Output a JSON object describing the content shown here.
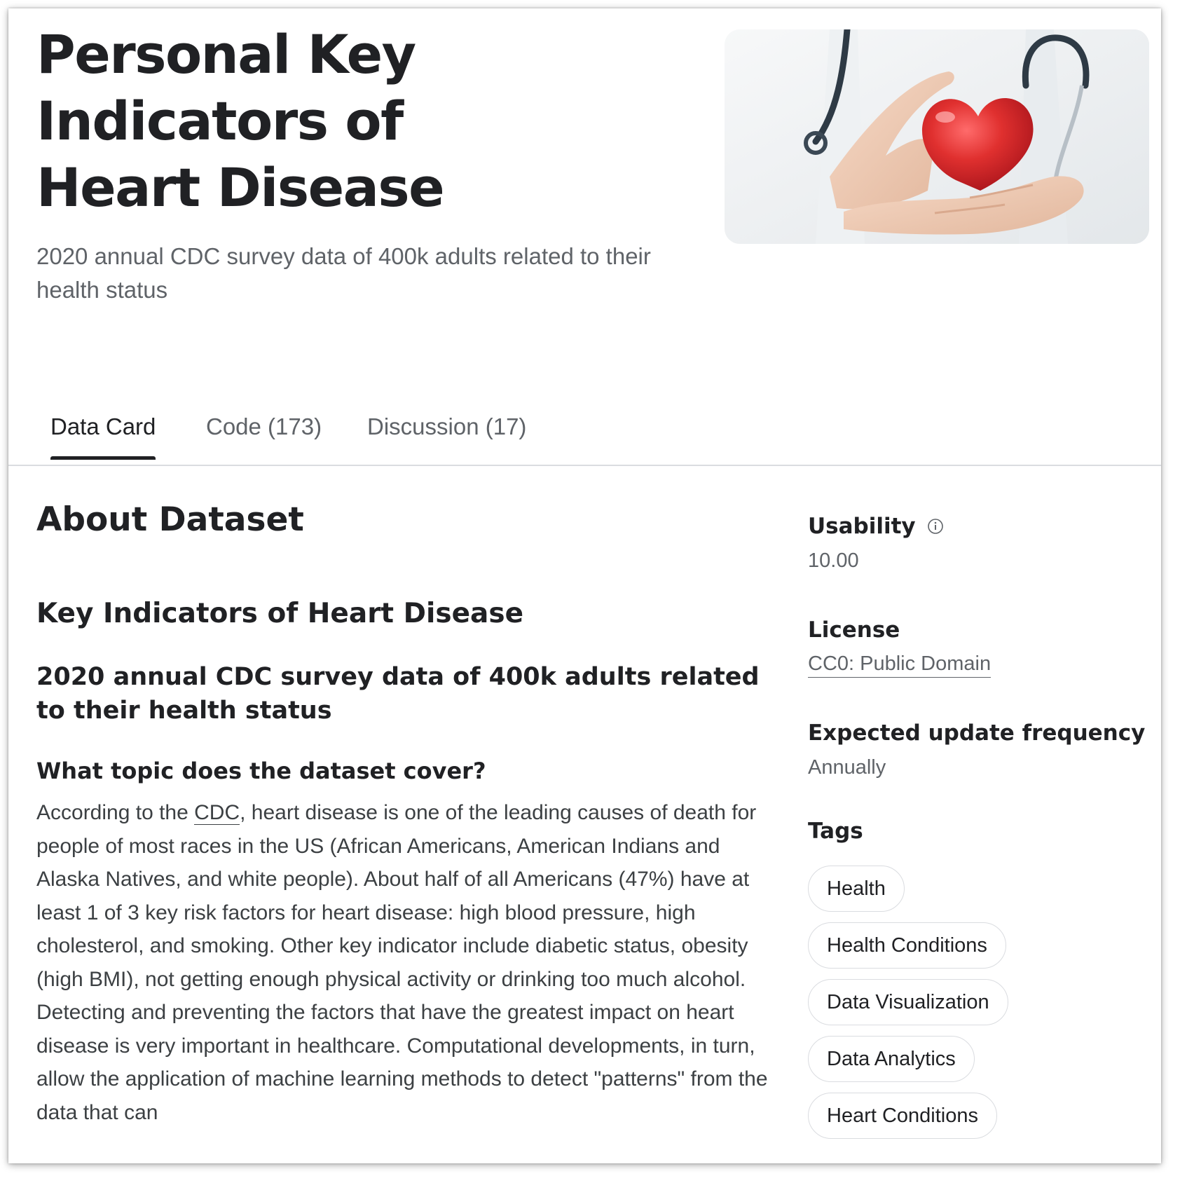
{
  "header": {
    "title": "Personal Key Indicators of Heart Disease",
    "subtitle": "2020 annual CDC survey data of 400k adults related to their health status"
  },
  "tabs": [
    {
      "label": "Data Card",
      "active": true
    },
    {
      "label": "Code (173)",
      "active": false
    },
    {
      "label": "Discussion (17)",
      "active": false
    }
  ],
  "about": {
    "heading": "About Dataset",
    "h2": "Key Indicators of Heart Disease",
    "h3": "2020 annual CDC survey data of 400k adults related to their health status",
    "h4": "What topic does the dataset cover?",
    "para_prefix": "According to the ",
    "para_link": "CDC",
    "para_rest": ", heart disease is one of the leading causes of death for people of most races in the US (African Americans, American Indians and Alaska Natives, and white people). About half of all Americans (47%) have at least 1 of 3 key risk factors for heart disease: high blood pressure, high cholesterol, and smoking. Other key indicator include diabetic status, obesity (high BMI), not getting enough physical activity or drinking too much alcohol. Detecting and preventing the factors that have the greatest impact on heart disease is very important in healthcare. Computational developments, in turn, allow the application of machine learning methods to detect \"patterns\" from the data that can"
  },
  "sidebar": {
    "usability_label": "Usability",
    "usability_value": "10.00",
    "license_label": "License",
    "license_value": "CC0: Public Domain",
    "frequency_label": "Expected update frequency",
    "frequency_value": "Annually",
    "tags_label": "Tags",
    "tags": [
      "Health",
      "Health Conditions",
      "Data Visualization",
      "Data Analytics",
      "Heart Conditions"
    ]
  },
  "icons": {
    "info": "info-circle-icon",
    "hero_image": "heart-in-hands-photo"
  },
  "colors": {
    "heart": "#d92b2b",
    "text": "#202124",
    "muted": "#5f6368"
  }
}
